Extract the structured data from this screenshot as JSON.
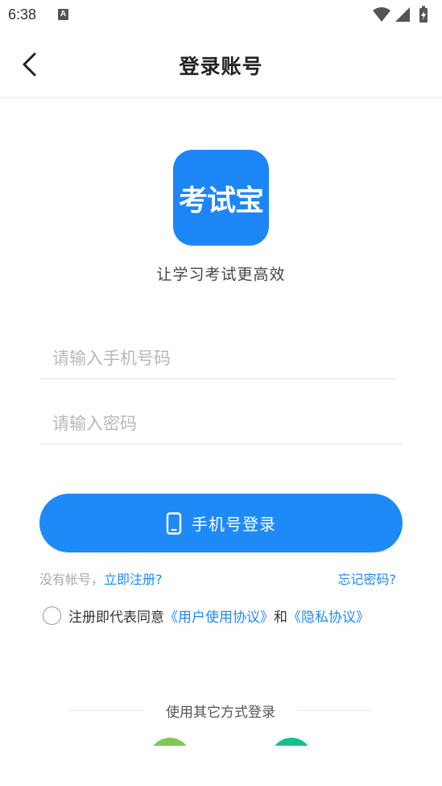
{
  "status_bar": {
    "time": "6:38",
    "notification_badge": "A",
    "icons": [
      "wifi-icon",
      "signal-icon",
      "battery-charging-icon"
    ]
  },
  "header": {
    "title": "登录账号",
    "back_icon": "chevron-left-icon"
  },
  "app": {
    "logo_text": "考试宝",
    "slogan": "让学习考试更高效",
    "brand_color": "#1e8af7"
  },
  "form": {
    "phone_placeholder": "请输入手机号码",
    "phone_value": "",
    "password_placeholder": "请输入密码",
    "password_value": "",
    "login_button_label": "手机号登录",
    "login_button_icon": "mobile-phone-icon"
  },
  "links": {
    "no_account": "没有帐号，",
    "register": "立即注册?",
    "forgot_password": "忘记密码?"
  },
  "agreement": {
    "prefix": "注册即代表同意",
    "user_agreement": "《用户使用协议》",
    "conjunction": "和",
    "privacy_policy": "《隐私协议》",
    "checked": false
  },
  "other_login": {
    "label": "使用其它方式登录",
    "buttons": [
      {
        "name": "wechat-login",
        "color": "#7cc85a"
      },
      {
        "name": "other-login",
        "color": "#19bf8a"
      }
    ]
  }
}
